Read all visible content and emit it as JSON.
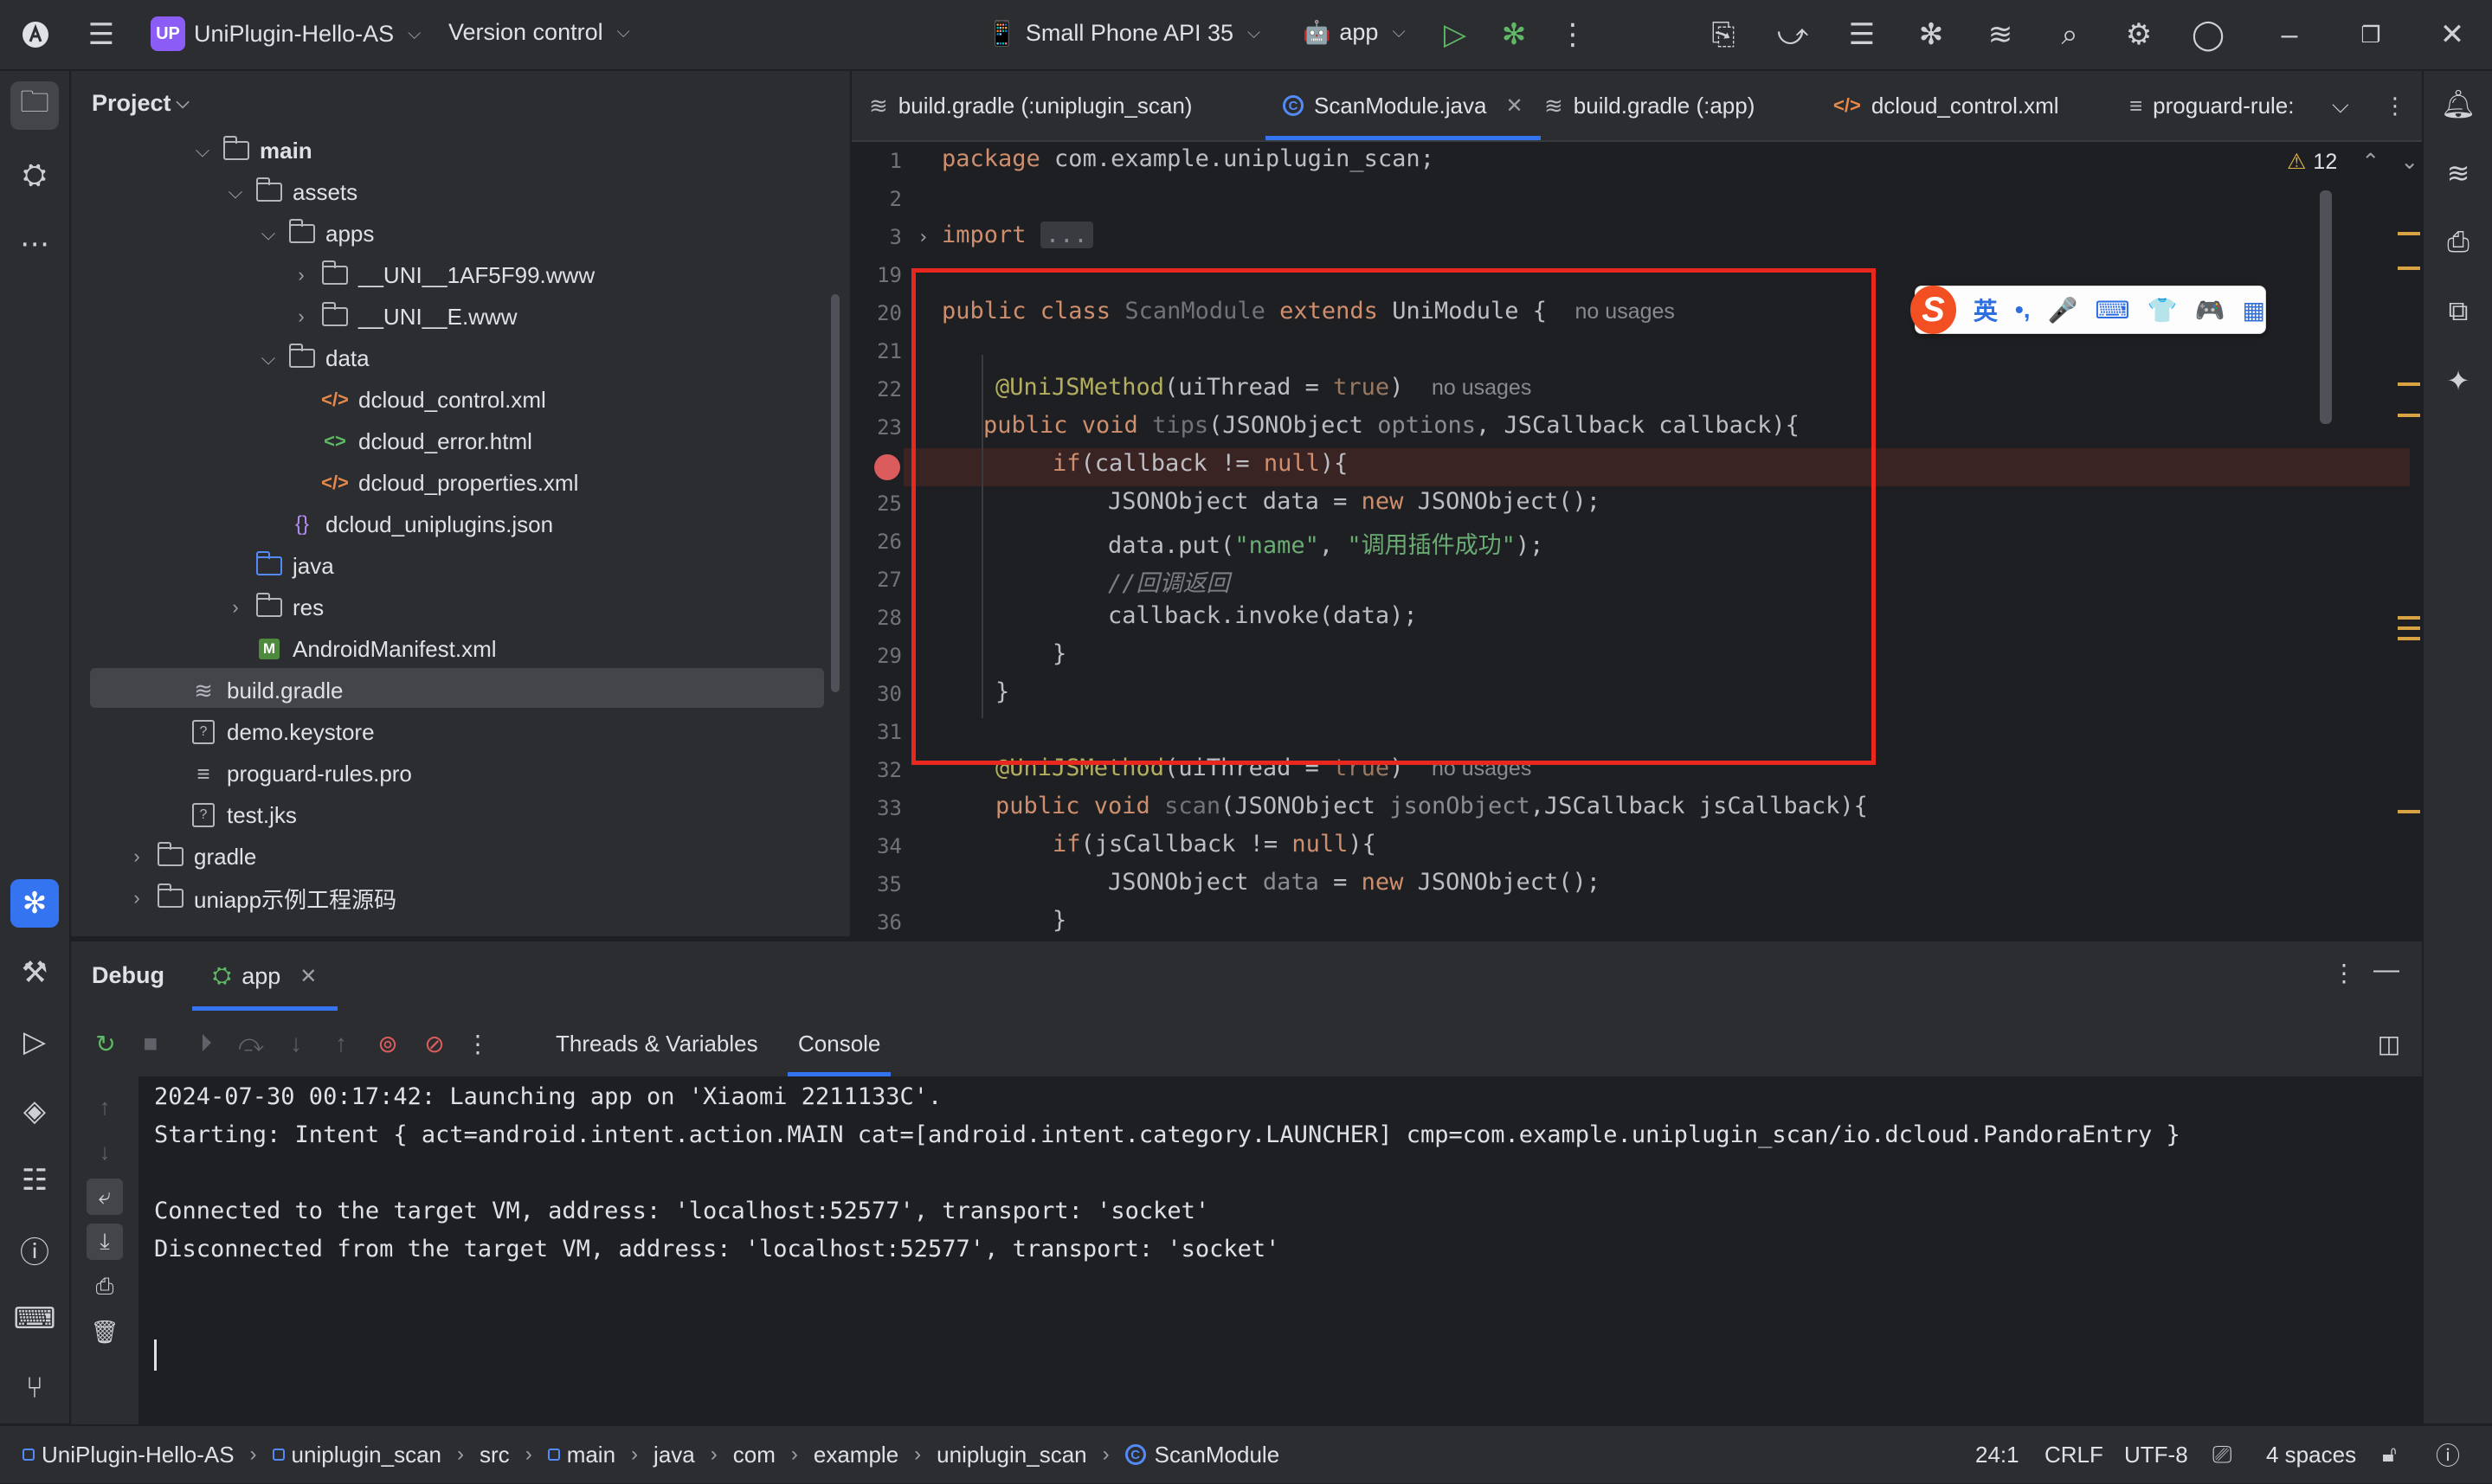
{
  "titlebar": {
    "project_badge": "UP",
    "project_name": "UniPlugin-Hello-AS",
    "vcs": "Version control",
    "device": "Small Phone API 35",
    "run_config": "app"
  },
  "project_panel": {
    "title": "Project",
    "tree": [
      {
        "label": "main",
        "bold": true
      },
      {
        "label": "assets"
      },
      {
        "label": "apps"
      },
      {
        "label": "__UNI__1AF5F99.www"
      },
      {
        "label": "__UNI__E.www"
      },
      {
        "label": "data"
      },
      {
        "label": "dcloud_control.xml"
      },
      {
        "label": "dcloud_error.html"
      },
      {
        "label": "dcloud_properties.xml"
      },
      {
        "label": "dcloud_uniplugins.json"
      },
      {
        "label": "java"
      },
      {
        "label": "res"
      },
      {
        "label": "AndroidManifest.xml"
      },
      {
        "label": "build.gradle"
      },
      {
        "label": "demo.keystore"
      },
      {
        "label": "proguard-rules.pro"
      },
      {
        "label": "test.jks"
      },
      {
        "label": "gradle"
      },
      {
        "label": "uniapp示例工程源码"
      }
    ]
  },
  "editor": {
    "tabs": [
      {
        "label": "build.gradle (:uniplugin_scan)"
      },
      {
        "label": "ScanModule.java",
        "active": true
      },
      {
        "label": "build.gradle (:app)"
      },
      {
        "label": "dcloud_control.xml"
      },
      {
        "label": "proguard-rule:"
      }
    ],
    "warnings": "12",
    "line_numbers": [
      "1",
      "2",
      "3",
      "19",
      "20",
      "21",
      "22",
      "23",
      "24",
      "25",
      "26",
      "27",
      "28",
      "29",
      "30",
      "31",
      "32",
      "33",
      "34",
      "35",
      "36"
    ],
    "hints": {
      "no_usages": "no usages"
    },
    "code": {
      "l1_kw": "package",
      "l1_rest": " com.example.uniplugin_scan;",
      "l3_kw": "import",
      "l3_dots": "...",
      "l20_a": "public class ",
      "l20_b": "ScanModule",
      "l20_c": " extends ",
      "l20_d": "UniModule {",
      "l22_ann": "@UniJSMethod",
      "l22_a": "(uiThread = ",
      "l22_b": "true",
      "l22_c": ")",
      "l23_kw": "public void ",
      "l23_name": "tips",
      "l23_a": "(JSONObject ",
      "l23_p": "options",
      "l23_b": ", JSCallback callback){",
      "l24_kw": "if",
      "l24_a": "(callback != ",
      "l24_null": "null",
      "l24_b": "){",
      "l25_a": "JSONObject data = ",
      "l25_new": "new",
      "l25_b": " JSONObject();",
      "l26_a": "data.put(",
      "l26_s1": "\"name\"",
      "l26_b": ", ",
      "l26_s2": "\"调用插件成功\"",
      "l26_c": ");",
      "l27_cmt": "//回调返回",
      "l28": "callback.invoke(data);",
      "l29": "}",
      "l30": "}",
      "l32_ann": "@UniJSMethod",
      "l32_a": "(uiThread = ",
      "l32_b": "true",
      "l32_c": ")",
      "l33_kw": "public void ",
      "l33_name": "scan",
      "l33_a": "(JSONObject ",
      "l33_p": "jsonObject",
      "l33_b": ",JSCallback jsCallback){",
      "l34_kw": "if",
      "l34_a": "(jsCallback != ",
      "l34_null": "null",
      "l34_b": "){",
      "l35_a": "JSONObject ",
      "l35_p": "data",
      "l35_b": " = ",
      "l35_new": "new",
      "l35_c": " JSONObject();",
      "l36": "}"
    }
  },
  "ime": {
    "logo": "S",
    "items": [
      "英",
      "•,",
      "🎤",
      "⌨",
      "👕",
      "🎮",
      "▦"
    ]
  },
  "debug": {
    "title": "Debug",
    "tab": "app",
    "subtabs": [
      "Threads & Variables",
      "Console"
    ],
    "console_lines": [
      "2024-07-30 00:17:42: Launching app on 'Xiaomi 2211133C'.",
      "Starting: Intent { act=android.intent.action.MAIN cat=[android.intent.category.LAUNCHER] cmp=com.example.uniplugin_scan/io.dcloud.PandoraEntry }",
      "",
      "Connected to the target VM, address: 'localhost:52577', transport: 'socket'",
      "Disconnected from the target VM, address: 'localhost:52577', transport: 'socket'"
    ]
  },
  "statusbar": {
    "breadcrumbs": [
      "UniPlugin-Hello-AS",
      "uniplugin_scan",
      "src",
      "main",
      "java",
      "com",
      "example",
      "uniplugin_scan",
      "ScanModule"
    ],
    "position": "24:1",
    "line_sep": "CRLF",
    "encoding": "UTF-8",
    "indent": "4 spaces"
  },
  "colors": {
    "accent": "#3574f0",
    "highlight_box": "#e8271f",
    "breakpoint": "#db5c5c"
  }
}
